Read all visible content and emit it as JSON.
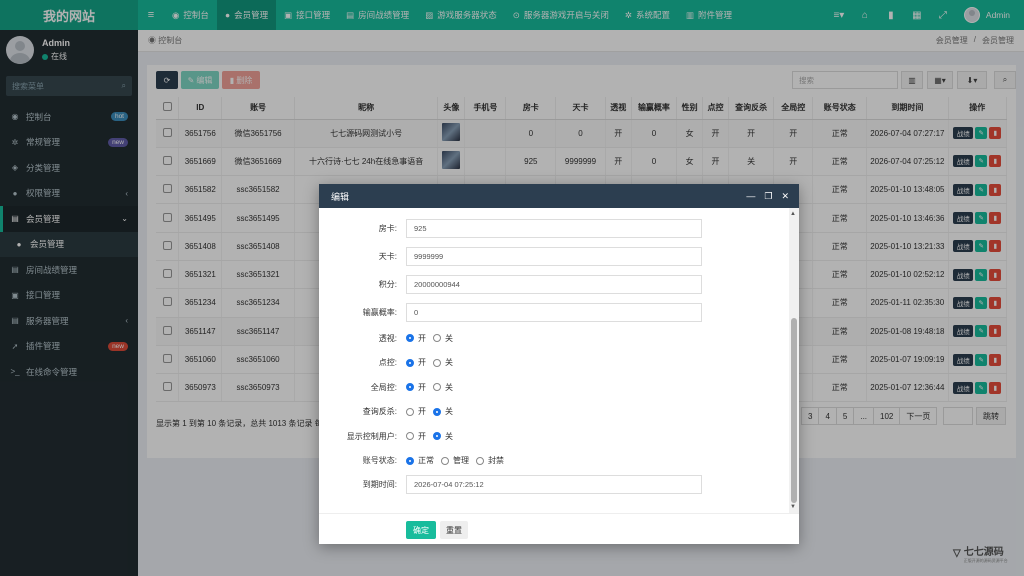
{
  "app": {
    "logo": "我的网站"
  },
  "topnav": [
    {
      "icon": "dashboard-icon",
      "glyph": "◉",
      "label": "控制台"
    },
    {
      "icon": "user-icon",
      "glyph": "●",
      "label": "会员管理"
    },
    {
      "icon": "plug-icon",
      "glyph": "▣",
      "label": "接口管理"
    },
    {
      "icon": "server-icon",
      "glyph": "▤",
      "label": "房间战绩管理"
    },
    {
      "icon": "image-icon",
      "glyph": "▨",
      "label": "游戏服务器状态"
    },
    {
      "icon": "power-icon",
      "glyph": "⊙",
      "label": "服务器游戏开启与关闭"
    },
    {
      "icon": "gear-icon",
      "glyph": "✲",
      "label": "系统配置"
    },
    {
      "icon": "file-icon",
      "glyph": "▥",
      "label": "附件管理"
    }
  ],
  "user": {
    "name": "Admin",
    "status": "在线"
  },
  "sidebar": {
    "search_placeholder": "搜索菜单",
    "items": [
      {
        "icon": "dashboard-icon",
        "glyph": "◉",
        "label": "控制台",
        "badge": "hot"
      },
      {
        "icon": "cogs-icon",
        "glyph": "✲",
        "label": "常规管理",
        "badge": "new"
      },
      {
        "icon": "category-icon",
        "glyph": "◈",
        "label": "分类管理"
      },
      {
        "icon": "group-icon",
        "glyph": "●",
        "label": "权限管理",
        "arrow": "‹"
      },
      {
        "icon": "list-icon",
        "glyph": "▤",
        "label": "会员管理",
        "arrow": "⌄"
      },
      {
        "icon": "user-icon",
        "glyph": "●",
        "label": "会员管理"
      },
      {
        "icon": "server-icon",
        "glyph": "▤",
        "label": "房间战绩管理"
      },
      {
        "icon": "plug-icon",
        "glyph": "▣",
        "label": "接口管理"
      },
      {
        "icon": "server-icon",
        "glyph": "▤",
        "label": "服务器管理",
        "arrow": "‹"
      },
      {
        "icon": "rocket-icon",
        "glyph": "➚",
        "label": "插件管理",
        "badge": "new"
      },
      {
        "icon": "terminal-icon",
        "glyph": ">_",
        "label": "在线命令管理"
      }
    ]
  },
  "breadcrumb": {
    "page": "控制台",
    "path": [
      "会员管理",
      "会员管理"
    ]
  },
  "toolbar": {
    "edit": "编辑",
    "delete": "删除",
    "search_placeholder": "搜索"
  },
  "table": {
    "columns": [
      "ID",
      "账号",
      "昵称",
      "头像",
      "手机号",
      "房卡",
      "天卡",
      "透视",
      "输赢概率",
      "性别",
      "点控",
      "查询反杀",
      "全局控",
      "账号状态",
      "到期时间",
      "操作"
    ],
    "rows": [
      [
        "3651756",
        "微信3651756",
        "七七源码网测试小号",
        "",
        "",
        "0",
        "0",
        "开",
        "0",
        "女",
        "开",
        "开",
        "开",
        "正常",
        "2026-07-04 07:27:17"
      ],
      [
        "3651669",
        "微信3651669",
        "十六行诗·七七 24h在线急事语音",
        "",
        "",
        "925",
        "9999999",
        "开",
        "0",
        "女",
        "开",
        "关",
        "开",
        "正常",
        "2026-07-04 07:25:12"
      ],
      [
        "3651582",
        "ssc3651582",
        "",
        "",
        "",
        "",
        "",
        "",
        "",
        "",
        "",
        "",
        "",
        "正常",
        "2025-01-10 13:48:05"
      ],
      [
        "3651495",
        "ssc3651495",
        "",
        "",
        "",
        "",
        "",
        "",
        "",
        "",
        "",
        "",
        "",
        "正常",
        "2025-01-10 13:46:36"
      ],
      [
        "3651408",
        "ssc3651408",
        "",
        "",
        "",
        "",
        "",
        "",
        "",
        "",
        "",
        "",
        "",
        "正常",
        "2025-01-10 13:21:33"
      ],
      [
        "3651321",
        "ssc3651321",
        "",
        "",
        "",
        "",
        "",
        "",
        "",
        "",
        "",
        "",
        "",
        "正常",
        "2025-01-10 02:52:12"
      ],
      [
        "3651234",
        "ssc3651234",
        "",
        "",
        "",
        "",
        "",
        "",
        "",
        "",
        "",
        "",
        "",
        "正常",
        "2025-01-11 02:35:30"
      ],
      [
        "3651147",
        "ssc3651147",
        "",
        "",
        "",
        "",
        "",
        "",
        "",
        "",
        "",
        "",
        "",
        "正常",
        "2025-01-08 19:48:18"
      ],
      [
        "3651060",
        "ssc3651060",
        "",
        "",
        "",
        "",
        "",
        "",
        "",
        "",
        "",
        "",
        "",
        "正常",
        "2025-01-07 19:09:19"
      ],
      [
        "3650973",
        "ssc3650973",
        "",
        "",
        "",
        "",
        "",
        "",
        "",
        "",
        "",
        "",
        "",
        "正常",
        "2025-01-07 12:36:44"
      ]
    ],
    "action_label": "战绩"
  },
  "pager": {
    "info": "显示第 1 到第 10 条记录，总共 1013 条记录 每",
    "pages": [
      "3",
      "4",
      "5",
      "...",
      "102",
      "下一页"
    ],
    "goto": "跳转"
  },
  "watermark": {
    "text": "七七源码",
    "sub": "正版开源的源码资源平台"
  },
  "modal": {
    "title": "编辑",
    "fields": [
      {
        "label": "房卡:",
        "value": "925"
      },
      {
        "label": "天卡:",
        "value": "9999999"
      },
      {
        "label": "积分:",
        "value": "20000000944"
      },
      {
        "label": "输赢概率:",
        "value": "0"
      }
    ],
    "radios": [
      {
        "label": "透视:",
        "options": [
          "开",
          "关"
        ],
        "selected": 0
      },
      {
        "label": "点控:",
        "options": [
          "开",
          "关"
        ],
        "selected": 0
      },
      {
        "label": "全局控:",
        "options": [
          "开",
          "关"
        ],
        "selected": 0
      },
      {
        "label": "查询反杀:",
        "options": [
          "开",
          "关"
        ],
        "selected": 1
      },
      {
        "label": "显示控制用户:",
        "options": [
          "开",
          "关"
        ],
        "selected": 1
      },
      {
        "label": "账号状态:",
        "options": [
          "正常",
          "管理",
          "封禁"
        ],
        "selected": 0
      }
    ],
    "expire": {
      "label": "到期时间:",
      "value": "2026-07-04 07:25:12"
    },
    "ok": "确定",
    "reset": "重置"
  },
  "colors": {
    "accent": "#18bc9c",
    "sidebar": "#222d32",
    "header_dark": "#2c3e50",
    "danger": "#e74c3c"
  }
}
